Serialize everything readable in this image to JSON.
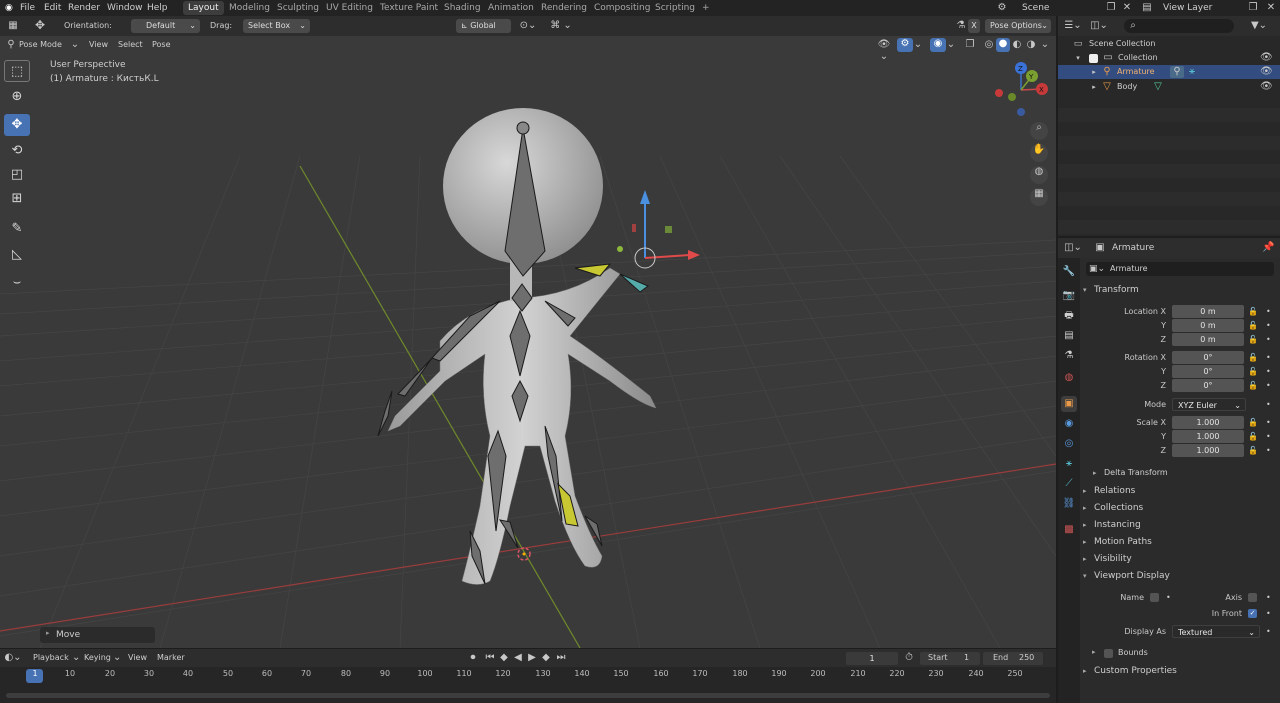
{
  "topbar": {
    "menus": [
      "File",
      "Edit",
      "Render",
      "Window",
      "Help"
    ],
    "workspaces": [
      "Layout",
      "Modeling",
      "Sculpting",
      "UV Editing",
      "Texture Paint",
      "Shading",
      "Animation",
      "Rendering",
      "Compositing",
      "Scripting"
    ],
    "active_workspace": "Layout",
    "add_tab": "+",
    "scene_name": "Scene",
    "view_layer": "View Layer"
  },
  "toolheader": {
    "orientation_label": "Orientation:",
    "orientation_value": "Default",
    "drag_label": "Drag:",
    "drag_value": "Select Box",
    "transform_space": "Global",
    "pose_options": "Pose Options",
    "x_label": "X"
  },
  "viewheader": {
    "mode": "Pose Mode",
    "menus": [
      "View",
      "Select",
      "Pose"
    ]
  },
  "viewport": {
    "perspective": "User Perspective",
    "active_object": "(1) Armature : КистьК.L",
    "last_op": "Move",
    "gizmo_axes": [
      "Z",
      "Y",
      "X"
    ]
  },
  "outliner": {
    "scene_collection": "Scene Collection",
    "collection": "Collection",
    "items": [
      {
        "name": "Armature",
        "selected": true
      },
      {
        "name": "Body",
        "selected": false
      }
    ]
  },
  "properties": {
    "object_name_header": "Armature",
    "object_name_field": "Armature",
    "transform_title": "Transform",
    "location": {
      "label_x": "Location X",
      "label_y": "Y",
      "label_z": "Z",
      "x": "0 m",
      "y": "0 m",
      "z": "0 m"
    },
    "rotation": {
      "label_x": "Rotation X",
      "label_y": "Y",
      "label_z": "Z",
      "x": "0°",
      "y": "0°",
      "z": "0°"
    },
    "mode_label": "Mode",
    "mode_value": "XYZ Euler",
    "scale": {
      "label_x": "Scale X",
      "label_y": "Y",
      "label_z": "Z",
      "x": "1.000",
      "y": "1.000",
      "z": "1.000"
    },
    "delta_transform": "Delta Transform",
    "sections": [
      "Relations",
      "Collections",
      "Instancing",
      "Motion Paths",
      "Visibility"
    ],
    "viewport_display": "Viewport Display",
    "vd_name": "Name",
    "vd_axis": "Axis",
    "vd_in_front": "In Front",
    "vd_display_as_label": "Display As",
    "vd_display_as_value": "Textured",
    "vd_bounds": "Bounds",
    "custom_properties": "Custom Properties"
  },
  "timeline": {
    "menus": [
      "Playback",
      "Keying",
      "View",
      "Marker"
    ],
    "current_frame": "1",
    "start_label": "Start",
    "start": "1",
    "end_label": "End",
    "end": "250",
    "ticks": [
      "1",
      "10",
      "20",
      "30",
      "40",
      "50",
      "60",
      "70",
      "80",
      "90",
      "100",
      "110",
      "120",
      "130",
      "140",
      "150",
      "160",
      "170",
      "180",
      "190",
      "200",
      "210",
      "220",
      "230",
      "240",
      "250"
    ]
  },
  "colors": {
    "accent": "#4772b3",
    "viewport_bg": "#3a3a3a",
    "x_axis": "#b34a4a",
    "y_axis": "#7a9a2a",
    "bone_selected": "#c8c832"
  }
}
